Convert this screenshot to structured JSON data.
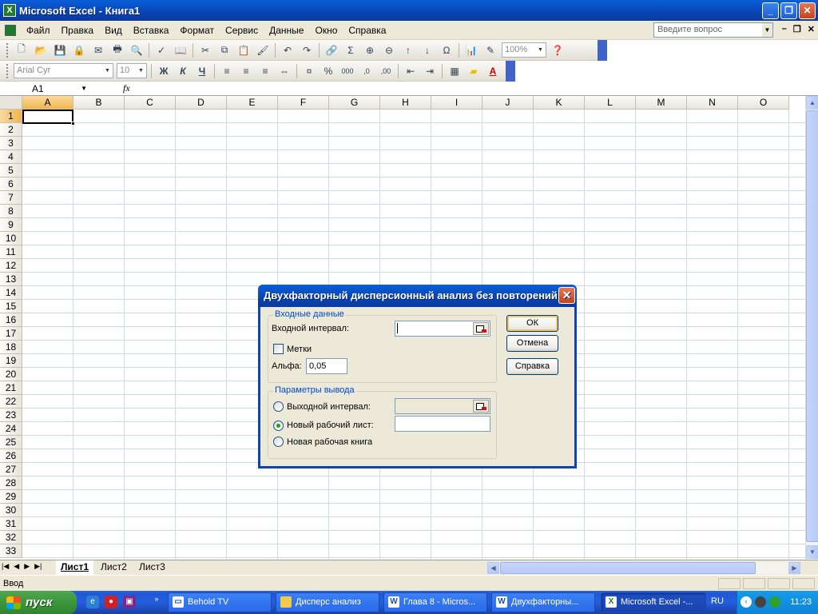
{
  "window": {
    "title": "Microsoft Excel - Книга1",
    "app_icon": "excel-icon"
  },
  "menu": {
    "items": [
      "Файл",
      "Правка",
      "Вид",
      "Вставка",
      "Формат",
      "Сервис",
      "Данные",
      "Окно",
      "Справка"
    ],
    "question_placeholder": "Введите вопрос"
  },
  "toolbar_standard": {
    "zoom": "100%"
  },
  "toolbar_format": {
    "font": "Arial Cyr",
    "size": "10",
    "bold": "Ж",
    "italic": "К",
    "underline": "Ч"
  },
  "formula_bar": {
    "name_box": "A1",
    "fx": "fx"
  },
  "sheet": {
    "columns": [
      "A",
      "B",
      "C",
      "D",
      "E",
      "F",
      "G",
      "H",
      "I",
      "J",
      "K",
      "L",
      "M",
      "N",
      "O"
    ],
    "rows": [
      "1",
      "2",
      "3",
      "4",
      "5",
      "6",
      "7",
      "8",
      "9",
      "10",
      "11",
      "12",
      "13",
      "14",
      "15",
      "16",
      "17",
      "18",
      "19",
      "20",
      "21",
      "22",
      "23",
      "24",
      "25",
      "26",
      "27",
      "28",
      "29",
      "30",
      "31",
      "32",
      "33"
    ],
    "active_cell": "A1"
  },
  "tabs": {
    "sheets": [
      "Лист1",
      "Лист2",
      "Лист3"
    ],
    "active": "Лист1"
  },
  "status": {
    "mode": "Ввод"
  },
  "dialog": {
    "title": "Двухфакторный дисперсионный анализ без повторений",
    "input_group": "Входные данные",
    "input_range_label": "Входной интервал:",
    "input_range_value": "",
    "labels_checkbox": "Метки",
    "labels_checked": false,
    "alpha_label": "Альфа:",
    "alpha_value": "0,05",
    "output_group": "Параметры вывода",
    "output_range_label": "Выходной интервал:",
    "new_sheet_label": "Новый рабочий лист:",
    "new_book_label": "Новая рабочая книга",
    "selected_output": "new_sheet",
    "ok": "ОК",
    "cancel": "Отмена",
    "help": "Справка"
  },
  "taskbar": {
    "start": "пуск",
    "items": [
      "Behold TV",
      "Дисперс анализ",
      "Глава 8 - Micros...",
      "Двухфакторны...",
      "Microsoft Excel -..."
    ],
    "active_index": 4,
    "language": "RU",
    "clock": "11:23"
  }
}
